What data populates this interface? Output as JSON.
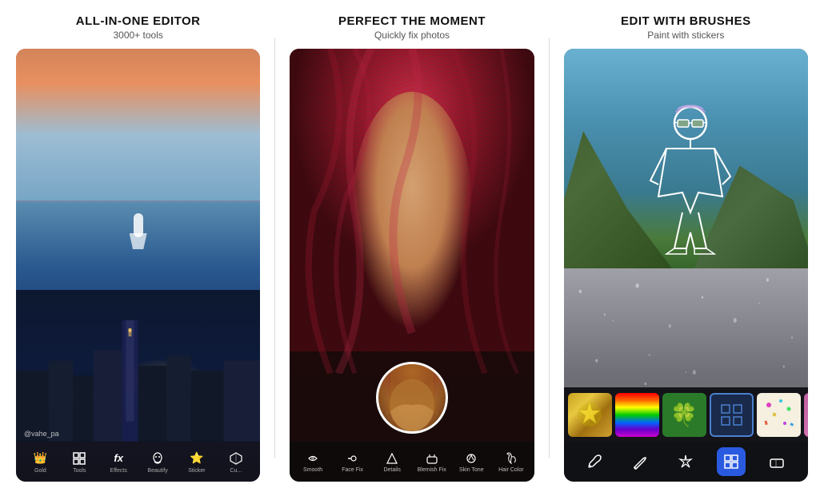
{
  "panels": [
    {
      "id": "panel1",
      "title": "ALL-IN-ONE EDITOR",
      "subtitle": "3000+ tools",
      "watermark": "@vahe_pa",
      "toolbar": [
        {
          "icon": "👑",
          "label": "Gold"
        },
        {
          "icon": "⬜",
          "label": "Tools"
        },
        {
          "icon": "fx",
          "label": "Effects"
        },
        {
          "icon": "🪞",
          "label": "Beautify"
        },
        {
          "icon": "⭐",
          "label": "Sticker"
        },
        {
          "icon": "⬡",
          "label": "Cu..."
        }
      ]
    },
    {
      "id": "panel2",
      "title": "PERFECT THE MOMENT",
      "subtitle": "Quickly fix photos",
      "toolbar": [
        {
          "icon": "💧",
          "label": "Smooth"
        },
        {
          "icon": "🔧",
          "label": "Face Fix"
        },
        {
          "icon": "💎",
          "label": "Details"
        },
        {
          "icon": "🩹",
          "label": "Blemish Fix"
        },
        {
          "icon": "🎨",
          "label": "Skin Tone"
        },
        {
          "icon": "✂️",
          "label": "Hair Color"
        }
      ]
    },
    {
      "id": "panel3",
      "title": "EDIT With BRUSHES",
      "subtitle": "Paint with stickers",
      "toolbar": [
        {
          "icon": "✏️",
          "label": "",
          "active": false
        },
        {
          "icon": "🖊️",
          "label": "",
          "active": false
        },
        {
          "icon": "✨",
          "label": "",
          "active": false
        },
        {
          "icon": "🔲",
          "label": "",
          "active": true
        },
        {
          "icon": "◻️",
          "label": "",
          "active": false
        }
      ]
    }
  ]
}
